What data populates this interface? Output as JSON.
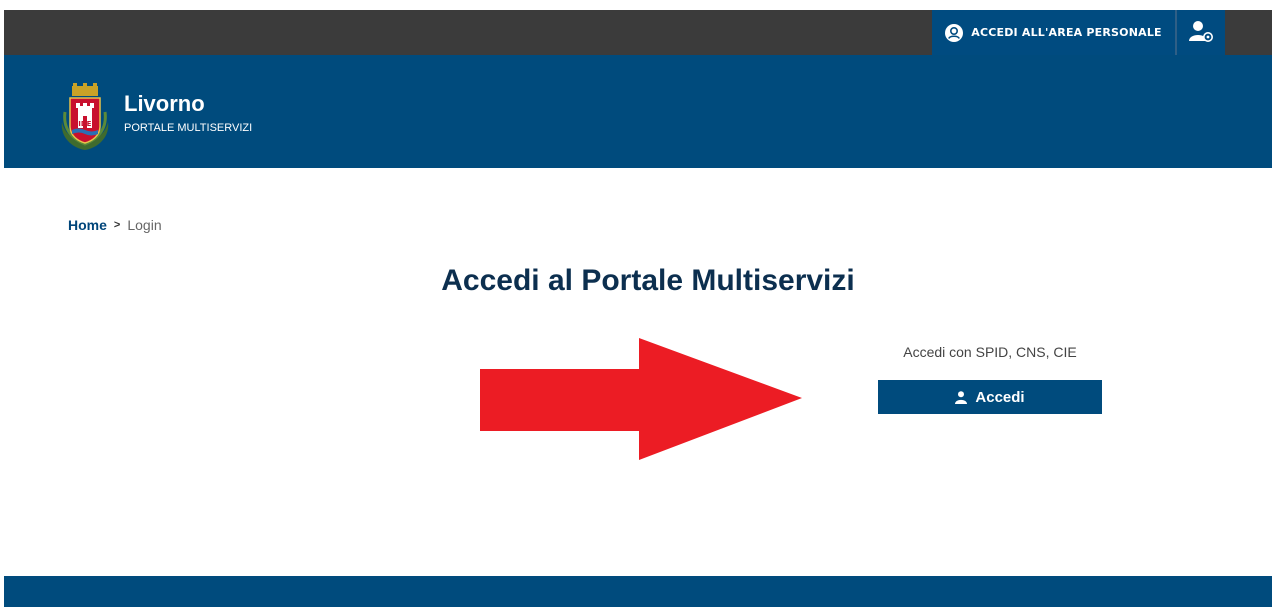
{
  "topbar": {
    "login_area_label": "ACCEDI ALL'AREA PERSONALE",
    "login_area_icon": "user-circle-icon",
    "settings_icon": "user-settings-icon"
  },
  "header": {
    "title": "Livorno",
    "subtitle": "PORTALE MULTISERVIZI",
    "logo_icon": "livorno-crest-icon"
  },
  "breadcrumb": {
    "home": "Home",
    "separator": ">",
    "current": "Login"
  },
  "main": {
    "title": "Accedi al Portale Multiservizi",
    "spid_label": "Accedi con SPID, CNS, CIE",
    "login_button_label": "Accedi",
    "login_button_icon": "user-icon",
    "annotation_icon": "red-arrow-icon"
  },
  "colors": {
    "primary": "#004b7d",
    "topbar": "#3b3b3b",
    "title": "#0c2f4f",
    "arrow": "#ec1c24"
  }
}
